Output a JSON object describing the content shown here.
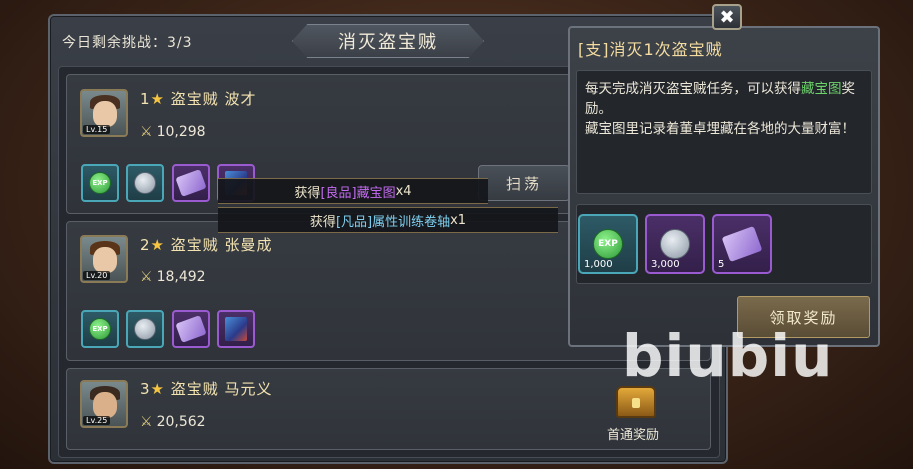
{
  "header": {
    "remaining_label": "今日剩余挑战：3/3",
    "title": "消灭盗宝贼"
  },
  "bandits": [
    {
      "rank": "1",
      "name": "盗宝贼 波才",
      "level": "Lv.15",
      "power": "10,298"
    },
    {
      "rank": "2",
      "name": "盗宝贼 张曼成",
      "level": "Lv.20",
      "power": "18,492"
    },
    {
      "rank": "3",
      "name": "盗宝贼 马元义",
      "level": "Lv.25",
      "power": "20,562"
    }
  ],
  "reward_icons": [
    "exp-icon",
    "silver-coin-icon",
    "scroll-icon",
    "book-icon"
  ],
  "sweep_label": "扫荡",
  "toasts": {
    "t1_prefix": "获得 ",
    "t1_item": "[良品]藏宝图",
    "t1_suffix": "x4",
    "t2_prefix": "获得 ",
    "t2_item": "[凡品]属性训练卷轴",
    "t2_suffix": "x1"
  },
  "first_clear_label": "首通奖励",
  "quest": {
    "title": "[支]消灭1次盗宝贼",
    "desc_part1": "每天完成消灭盗宝贼任务，可以获得",
    "desc_highlight": "藏宝图",
    "desc_part2": "奖励。",
    "desc_line2": "藏宝图里记录着董卓埋藏在各地的大量财富！",
    "rewards": [
      {
        "icon": "exp-icon",
        "qty": "1,000"
      },
      {
        "icon": "silver-coin-icon",
        "qty": "3,000"
      },
      {
        "icon": "scroll-icon",
        "qty": "5"
      }
    ],
    "claim_label": "领取奖励"
  },
  "close_glyph": "✖",
  "watermark": "biubiu",
  "colors": {
    "quality_good": "#c46bf0",
    "quality_common": "#7fd0f0",
    "highlight_green": "#6cd36a",
    "star_gold": "#f5c542"
  }
}
